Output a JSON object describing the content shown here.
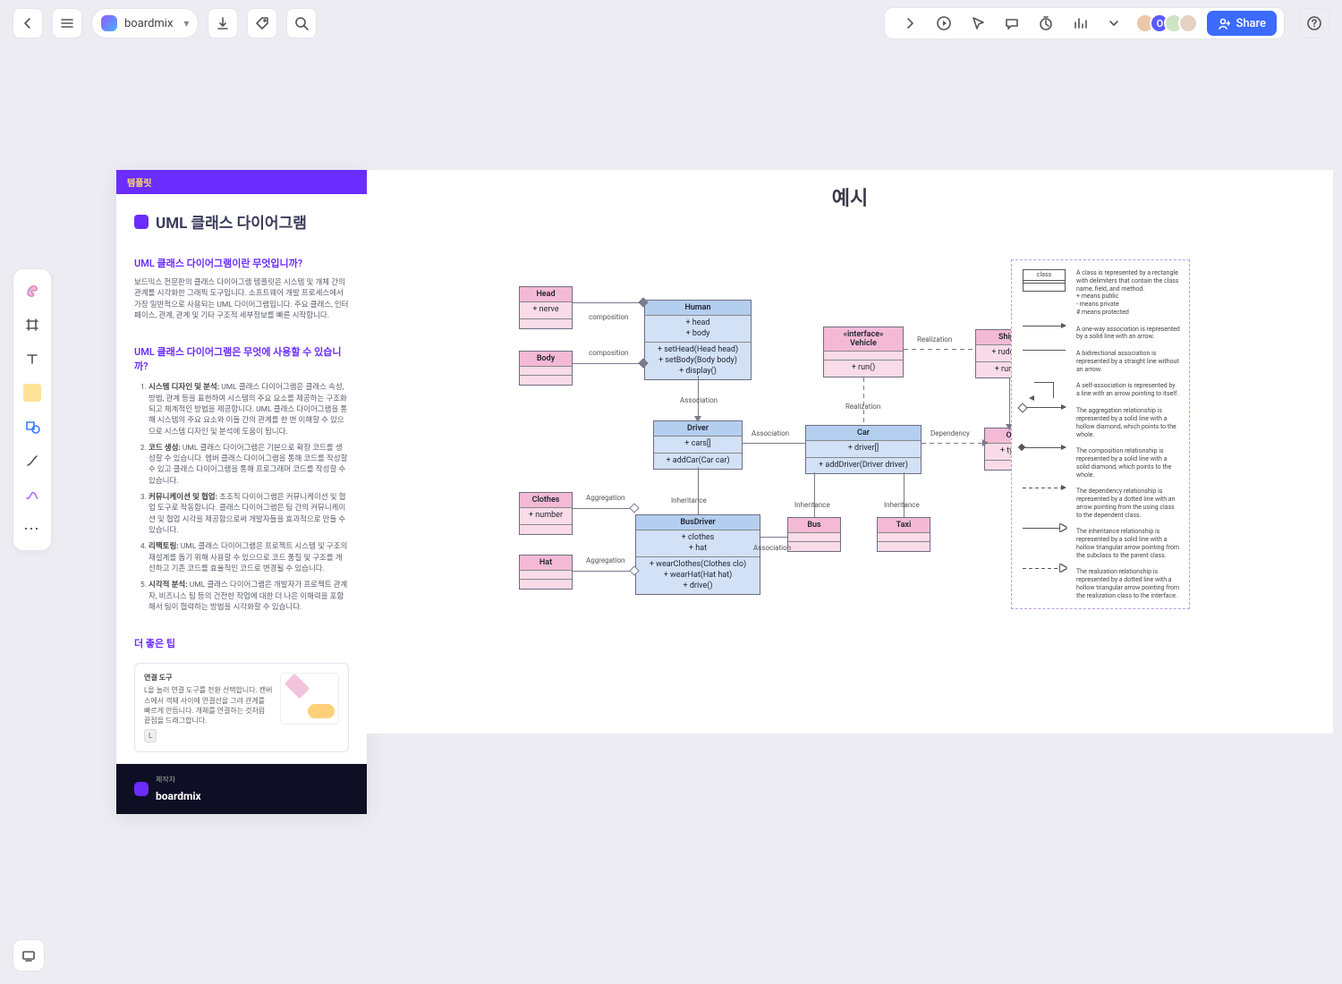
{
  "topbar": {
    "file_name": "boardmix",
    "share_label": "Share"
  },
  "toolbar": {
    "tools": [
      "shapes",
      "frame",
      "text",
      "sticky",
      "shape",
      "connector",
      "curve",
      "more"
    ]
  },
  "info_panel": {
    "header_tag": "템플릿",
    "title": "UML 클래스 다이어그램",
    "q1_title": "UML 클래스 다이어그램이란 무엇입니까?",
    "q1_body": "보드믹스 전문판의 클래스 다이어그램 템플릿은 시스템 및 개체 간의 관계를 시각화한 그래픽 도구입니다. 소프트웨어 개발 프로세스에서 가장 일반적으로 사용되는 UML 다이어그램입니다. 주요 클래스, 인터페이스, 관계, 관계 및 기타 구조적 세부정보를 빠른 시작합니다.",
    "q2_title": "UML 클래스 다이어그램은 무엇에 사용할 수 있습니까?",
    "q2_items": [
      {
        "b": "시스템 디자인 및 분석:",
        "t": "UML 클래스 다이어그램은 클래스 속성, 방법, 관계 등을 표현하여 시스템의 주요 요소를 제공하는 구조화되고 체계적인 방법을 제공합니다. UML 클래스 다이어그램을 통해 시스템의 주요 요소와 이들 간의 관계를 한 번 이해할 수 있으므로 시스템 디자인 및 분석에 도움이 됩니다."
      },
      {
        "b": "코드 생성:",
        "t": "UML 클래스 다이어그램은 기본으로 확장 코드를 생성할 수 있습니다. 멤버 클래스 다이어그램을 통해 코드를 작성할 수 있고 클래스 다이어그램을 통해 프로그래머 코드를 작성할 수 있습니다."
      },
      {
        "b": "커뮤니케이션 및 협업:",
        "t": "초조직 다이어그램은 커뮤니케이션 및 협업 도구로 작동합니다. 클래스 다이어그램은 팀 간의 커뮤니케이션 및 협업 시각을 제공함으로써 개발자들을 효과적으로 만들 수 있습니다."
      },
      {
        "b": "리팩토링:",
        "t": "UML 클래스 다이어그램은 프로젝트 시스템 및 구조의 재설계를 돕기 위해 사용할 수 있으므로 코드 품질 및 구조를 개선하고 기존 코드를 효율적인 코드로 변경될 수 있습니다."
      },
      {
        "b": "시각적 분석:",
        "t": "UML 클래스 다이어그램은 개발자가 프로젝트 관계자, 비즈니스 팀 등의 건전한 작업에 대한 더 나은 이해력을 포함해서 팀이 협력하는 방법을 시각화할 수 있습니다."
      }
    ],
    "tip_title": "더 좋은 팁",
    "tip_box": {
      "heading": "연결 도구",
      "body": "L을 눌러 연결 도구를 전환 선택합니다. 캔버스에서 객체 사이에 연결선을 그려 관계를 빠르게 만듭니다. 개체를 연결하는 것처럼 끝점을 드래그합니다.",
      "key": "L"
    },
    "footer_label": "제작자",
    "footer_brand": "boardmix"
  },
  "diagram": {
    "title": "예시",
    "classes": {
      "head": {
        "name": "Head",
        "attrs": "+ nerve",
        "ops": ""
      },
      "body": {
        "name": "Body",
        "attrs": "",
        "ops": ""
      },
      "human": {
        "name": "Human",
        "attrs": "+ head\n+ body",
        "ops": "+ setHead(Head head)\n+ setBody(Body body)\n+ display()"
      },
      "driver": {
        "name": "Driver",
        "attrs": "+ cars[]",
        "ops": "+ addCar(Car car)"
      },
      "busdriver": {
        "name": "BusDriver",
        "attrs": "+ clothes\n+ hat",
        "ops": "+ wearClothes(Clothes clo)\n+ wearHat(Hat hat)\n+ drive()"
      },
      "clothes": {
        "name": "Clothes",
        "attrs": "+ number",
        "ops": ""
      },
      "hat": {
        "name": "Hat",
        "attrs": "",
        "ops": ""
      },
      "vehicle": {
        "name": "«interface»\nVehicle",
        "attrs": "",
        "ops": "+ run()"
      },
      "car": {
        "name": "Car",
        "attrs": "+ driver[]",
        "ops": "+ addDriver(Driver driver)"
      },
      "bus": {
        "name": "Bus",
        "attrs": "",
        "ops": ""
      },
      "taxi": {
        "name": "Taxi",
        "attrs": "",
        "ops": ""
      },
      "ship": {
        "name": "Ship",
        "attrs": "+ rudder",
        "ops": "+ run()"
      },
      "oil": {
        "name": "Oil",
        "attrs": "+ type",
        "ops": ""
      }
    },
    "labels": {
      "composition1": "composition",
      "composition2": "composition",
      "association1": "Association",
      "association2": "Association",
      "association3": "Association",
      "aggregation1": "Aggregation",
      "aggregation2": "Aggregation",
      "inheritance1": "Inheritance",
      "inheritance2": "Inheritance",
      "inheritance3": "Inheritance",
      "realization1": "Realization",
      "realization2": "Realization",
      "dependency": "Dependency"
    }
  },
  "legend": {
    "class_label": "class",
    "class_desc": "A class is represented by a rectangle with delimiters that contain the class name, field, and method.\n+   means public\n-   means private\n#  means protected",
    "oneway": "A one-way association is represented by a solid line with an arrow.",
    "bidir": "A bidirectional association is represented by a straight line without an arrow.",
    "self": "A self-association is represented by a line with an arrow pointing to itself.",
    "agg": "The aggregation relationship is represented by a solid line with a hollow diamond, which points to the whole.",
    "comp": "The composition relationship is represented by a solid line with a solid diamond, which points to the whole.",
    "dep": "The dependency relationship is represented by a dotted line with an arrow pointing from the using class to the dependent class.",
    "inh": "The inheritance relationship is represented by a solid line with a hollow triangular arrow pointing from the subclass to the parent class.",
    "real": "The realization relationship is represented by a dotted line with a hollow triangular arrow pointing from the realization class to the interface."
  }
}
